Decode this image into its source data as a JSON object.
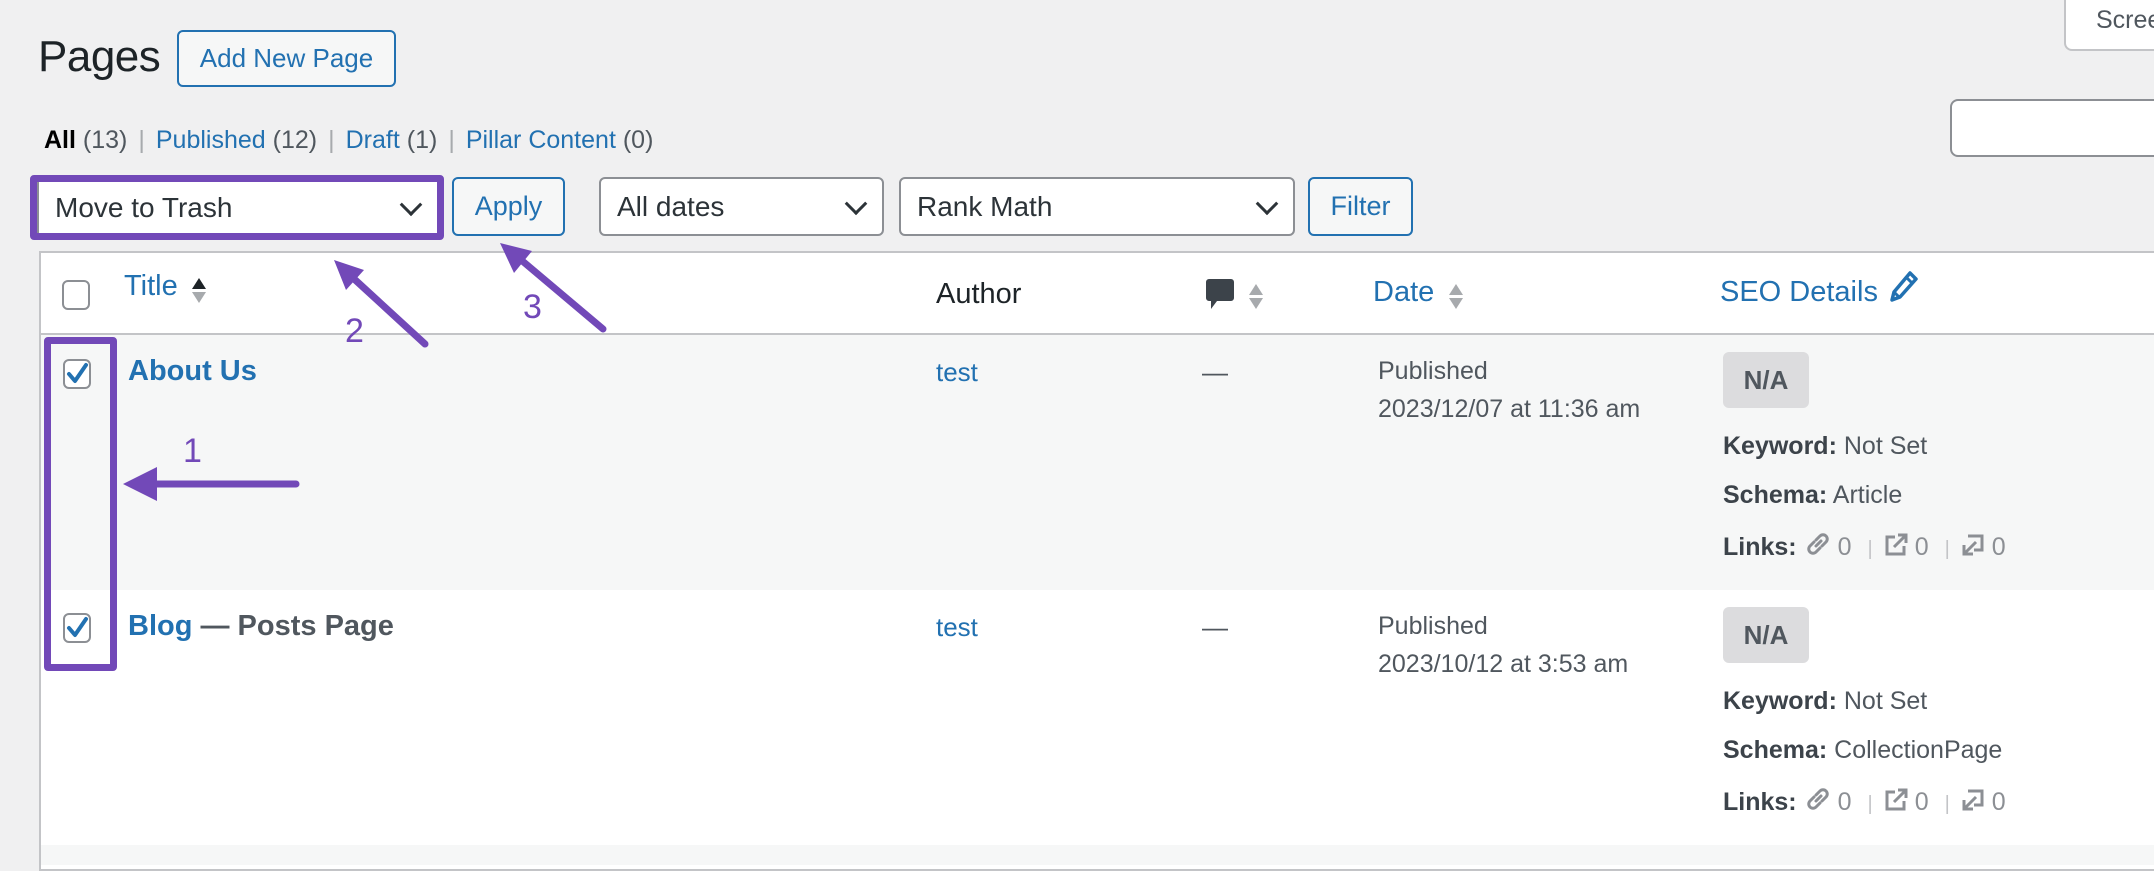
{
  "header": {
    "title": "Pages",
    "add_new_label": "Add New Page",
    "screen_options_label": "Screen Options",
    "search": {
      "value": "",
      "placeholder": ""
    }
  },
  "views": [
    {
      "label": "All",
      "count": "(13)",
      "current": true
    },
    {
      "label": "Published",
      "count": "(12)",
      "current": false
    },
    {
      "label": "Draft",
      "count": "(1)",
      "current": false
    },
    {
      "label": "Pillar Content",
      "count": "(0)",
      "current": false
    }
  ],
  "views_separator": "|",
  "toolbar": {
    "bulk_action": "Move to Trash",
    "apply_label": "Apply",
    "date_filter": "All dates",
    "seo_filter": "Rank Math",
    "filter_label": "Filter"
  },
  "table": {
    "columns": {
      "title": "Title",
      "author": "Author",
      "comments_icon": "comment-bubble-icon",
      "date": "Date",
      "seo": "SEO Details"
    },
    "rows": [
      {
        "checked": true,
        "title": "About Us",
        "state": "",
        "author": "test",
        "comments": "—",
        "date_status": "Published",
        "date_value": "2023/12/07 at 11:36 am",
        "seo_score": "N/A",
        "keyword_label": "Keyword:",
        "keyword": "Not Set",
        "schema_label": "Schema:",
        "schema": "Article",
        "links_label": "Links:",
        "internal_links": "0",
        "external_links": "0",
        "incoming_links": "0"
      },
      {
        "checked": true,
        "title": "Blog",
        "state": " — Posts Page",
        "author": "test",
        "comments": "—",
        "date_status": "Published",
        "date_value": "2023/10/12 at 3:53 am",
        "seo_score": "N/A",
        "keyword_label": "Keyword:",
        "keyword": "Not Set",
        "schema_label": "Schema:",
        "schema": "CollectionPage",
        "links_label": "Links:",
        "internal_links": "0",
        "external_links": "0",
        "incoming_links": "0"
      }
    ]
  },
  "annotations": {
    "color": "#7249b8",
    "step1": "1",
    "step2": "2",
    "step3": "3"
  }
}
